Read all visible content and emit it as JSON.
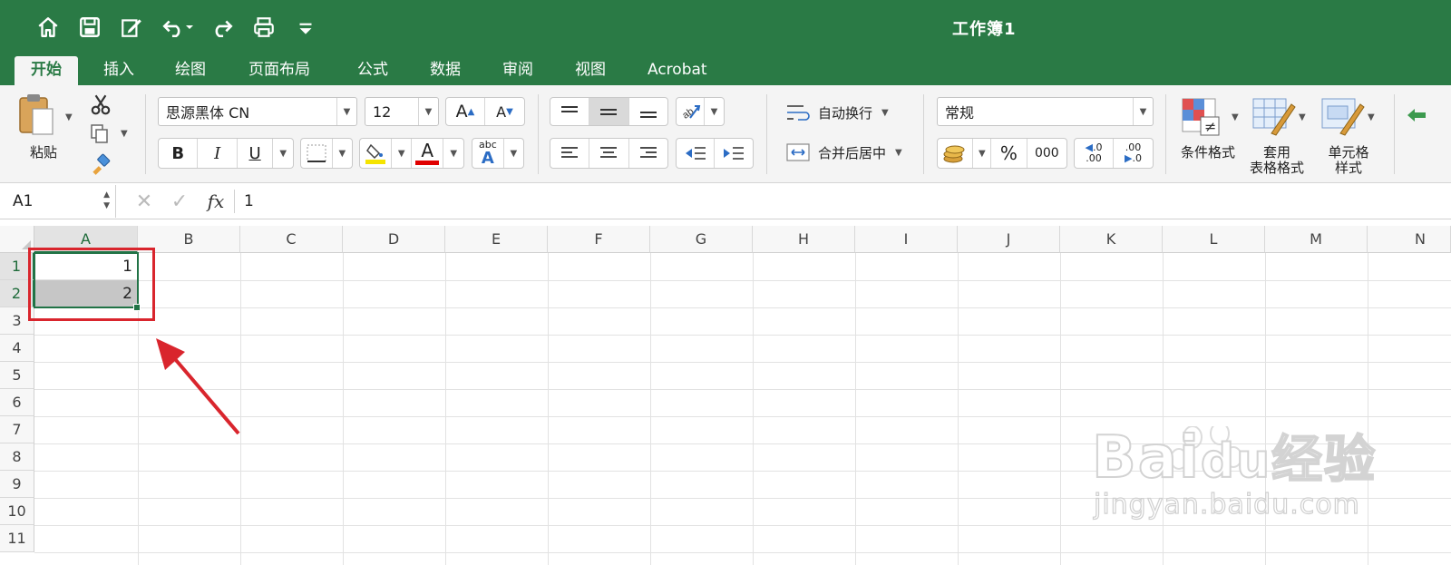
{
  "window": {
    "title": "工作簿1"
  },
  "qat": {
    "icons": [
      "home-icon",
      "save-icon",
      "edit-icon",
      "undo-icon",
      "redo-icon",
      "print-icon",
      "customize-icon"
    ]
  },
  "tabs": [
    {
      "label": "开始",
      "active": true
    },
    {
      "label": "插入"
    },
    {
      "label": "绘图"
    },
    {
      "label": "页面布局"
    },
    {
      "label": "公式"
    },
    {
      "label": "数据"
    },
    {
      "label": "审阅"
    },
    {
      "label": "视图"
    },
    {
      "label": "Acrobat"
    }
  ],
  "ribbon": {
    "paste_label": "粘贴",
    "font_name": "思源黑体 CN",
    "font_size": "12",
    "bold": "B",
    "italic": "I",
    "underline": "U",
    "font_color_letter": "A",
    "spell_top": "abc",
    "spell_bottom": "A",
    "wrap_text": "自动换行",
    "merge_center": "合并后居中",
    "number_format": "常规",
    "percent": "%",
    "thousands": "000",
    "inc_decimal_top": ".0",
    "inc_decimal_bottom": ".00",
    "dec_decimal_top": ".00",
    "dec_decimal_bottom": ".0",
    "conditional_format": "条件格式",
    "table_format_line1": "套用",
    "table_format_line2": "表格格式",
    "cell_styles_line1": "单元格",
    "cell_styles_line2": "样式",
    "grow_letter": "A",
    "shrink_letter": "A"
  },
  "colors": {
    "accent": "#217346",
    "titlebar": "#2a7a45",
    "highlight": "#d9252d"
  },
  "formula_bar": {
    "name_box": "A1",
    "cancel": "✕",
    "enter": "✓",
    "fx": "fx",
    "value": "1"
  },
  "sheet": {
    "columns": [
      "A",
      "B",
      "C",
      "D",
      "E",
      "F",
      "G",
      "H",
      "I",
      "J",
      "K",
      "L",
      "M",
      "N"
    ],
    "rows": [
      "1",
      "2",
      "3",
      "4",
      "5",
      "6",
      "7",
      "8",
      "9",
      "10",
      "11"
    ],
    "cells": {
      "A1": "1",
      "A2": "2"
    }
  },
  "watermark": {
    "brand": "Bai",
    "brand_suffix": "du",
    "product": "经验",
    "url": "jingyan.baidu.com"
  }
}
